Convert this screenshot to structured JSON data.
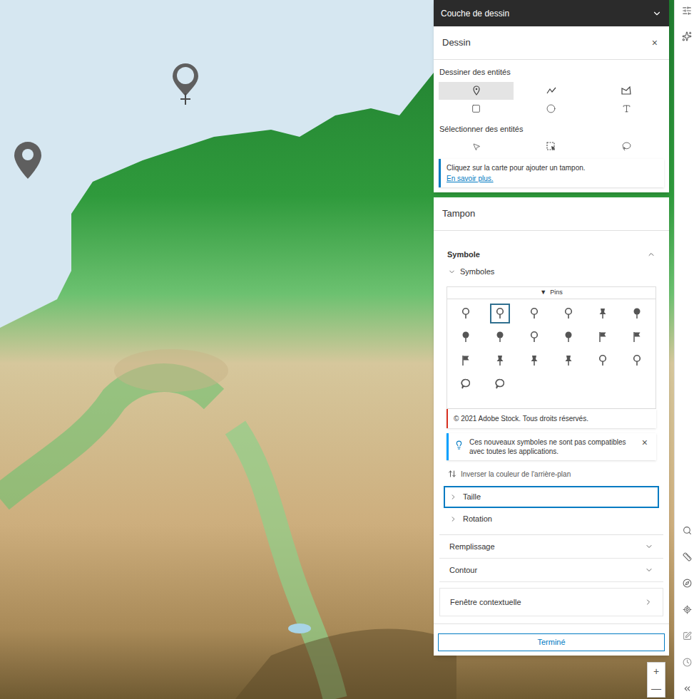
{
  "map": {
    "pins": [
      {
        "kind": "teardrop"
      },
      {
        "kind": "ring-cross"
      }
    ],
    "zoom": [
      "+",
      "—"
    ]
  },
  "layer_header": {
    "title": "Couche de dessin"
  },
  "draw_panel": {
    "title": "Dessin",
    "close": "×",
    "draw_label": "Dessiner des entités",
    "draw_tools": [
      {
        "kind": "point",
        "selected": true
      },
      {
        "kind": "polyline",
        "selected": false
      },
      {
        "kind": "polygon",
        "selected": false
      },
      {
        "kind": "rectangle",
        "selected": false
      },
      {
        "kind": "circle",
        "selected": false
      },
      {
        "kind": "text",
        "selected": false
      }
    ],
    "select_label": "Sélectionner des entités",
    "select_tools": [
      {
        "kind": "pointer",
        "selected": false
      },
      {
        "kind": "box",
        "selected": false
      },
      {
        "kind": "lasso",
        "selected": false
      }
    ],
    "hint": "Cliquez sur la carte pour ajouter un tampon.",
    "hint_link": "En savoir plus."
  },
  "stamp_panel": {
    "title": "Tampon",
    "symbol_section": {
      "title": "Symbole",
      "expanded": true
    },
    "symbols_group": {
      "title": "Symboles",
      "expanded": true
    },
    "category": {
      "arrow": "▼",
      "label": "Pins"
    },
    "symbols": [
      {
        "kind": "outline",
        "selected": false
      },
      {
        "kind": "outline",
        "selected": true
      },
      {
        "kind": "outline",
        "selected": false
      },
      {
        "kind": "outline",
        "selected": false
      },
      {
        "kind": "pushpin",
        "selected": false
      },
      {
        "kind": "filled",
        "selected": false
      },
      {
        "kind": "filled",
        "selected": false
      },
      {
        "kind": "filled",
        "selected": false
      },
      {
        "kind": "outline",
        "selected": false
      },
      {
        "kind": "filled",
        "selected": false
      },
      {
        "kind": "flag",
        "selected": false
      },
      {
        "kind": "flag",
        "selected": false
      },
      {
        "kind": "flag",
        "selected": false
      },
      {
        "kind": "pushpin",
        "selected": false
      },
      {
        "kind": "pushpin",
        "selected": false
      },
      {
        "kind": "pushpin",
        "selected": false
      },
      {
        "kind": "outline",
        "selected": false
      },
      {
        "kind": "outline",
        "selected": false
      },
      {
        "kind": "speech",
        "selected": false
      },
      {
        "kind": "speech",
        "selected": false
      }
    ],
    "copyright": "© 2021 Adobe Stock. Tous droits réservés.",
    "notice": {
      "text": "Ces nouveaux symboles ne sont pas compatibles avec toutes les applications.",
      "close": "×"
    },
    "invert": "Inverser la couleur de l'arrière-plan",
    "subsections": [
      {
        "title": "Taille",
        "expanded": false,
        "focused": true
      },
      {
        "title": "Rotation",
        "expanded": false,
        "focused": false
      }
    ],
    "sections": [
      {
        "title": "Remplissage",
        "kind": "accordion",
        "expanded": false
      },
      {
        "title": "Contour",
        "kind": "accordion",
        "expanded": false
      },
      {
        "title": "Fenêtre contextuelle",
        "kind": "link",
        "expanded": false
      }
    ],
    "done": "Terminé"
  }
}
